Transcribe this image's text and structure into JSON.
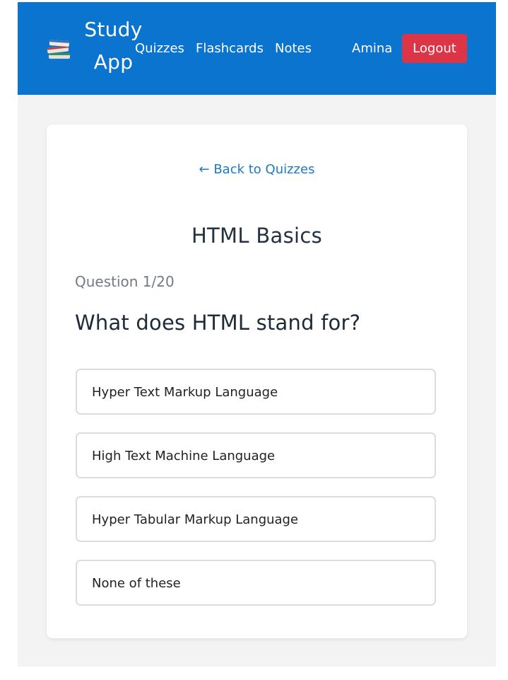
{
  "navbar": {
    "brand_icon": "books-icon",
    "brand_line1": "Study",
    "brand_line2": "App",
    "links": [
      "Quizzes",
      "Flashcards",
      "Notes"
    ],
    "user_name": "Amina",
    "logout_label": "Logout",
    "bg_color": "#0a74cf"
  },
  "quiz": {
    "back_label": "← Back to Quizzes",
    "title": "HTML Basics",
    "counter": "Question 1/20",
    "question": "What does HTML stand for?",
    "options": [
      "Hyper Text Markup Language",
      "High Text Machine Language",
      "Hyper Tabular Markup Language",
      "None of these"
    ]
  },
  "colors": {
    "accent": "#0a74cf",
    "danger": "#dc3548",
    "link": "#1a7bc4"
  }
}
